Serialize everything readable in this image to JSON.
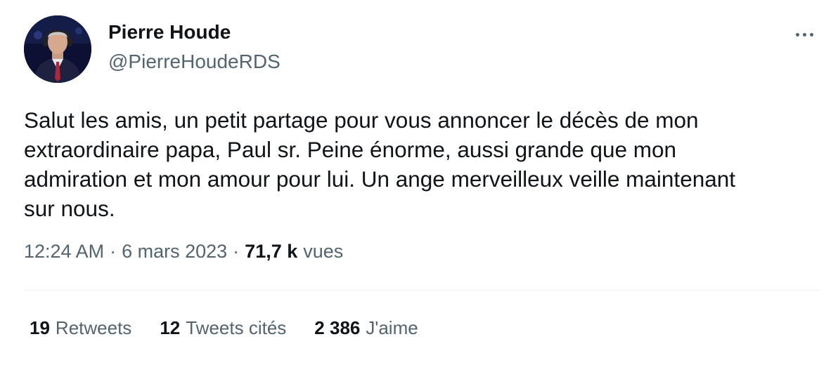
{
  "author": {
    "display_name": "Pierre Houde",
    "handle": "@PierreHoudeRDS",
    "avatar_icon": "profile-photo"
  },
  "menu": {
    "more_icon": "more-dots-icon"
  },
  "tweet": {
    "text": "Salut les amis, un petit partage pour vous annoncer le décès de mon\nextraordinaire papa, Paul sr.  Peine énorme, aussi grande que mon\nadmiration et mon amour pour lui. Un ange merveilleux veille maintenant\nsur nous."
  },
  "meta": {
    "time": "12:24 AM",
    "separator": "·",
    "date": "6 mars 2023",
    "views_count": "71,7 k",
    "views_label": "vues"
  },
  "stats": {
    "retweets_count": "19",
    "retweets_label": "Retweets",
    "quotes_count": "12",
    "quotes_label": "Tweets cités",
    "likes_count": "2 386",
    "likes_label": "J'aime"
  },
  "colors": {
    "primary_text": "#0f1419",
    "secondary_text": "#536471",
    "divider": "#eff3f4"
  }
}
